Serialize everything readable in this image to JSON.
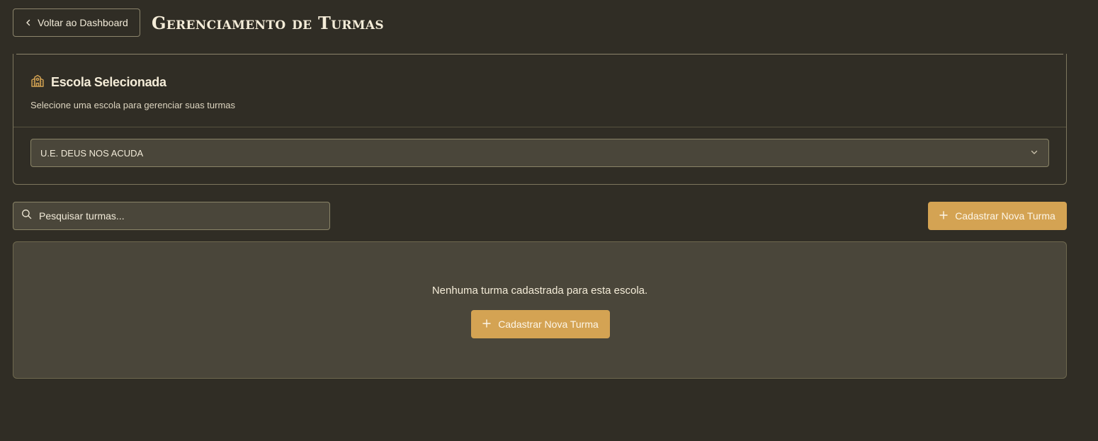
{
  "header": {
    "back_label": "Voltar ao Dashboard",
    "title": "Gerenciamento de Turmas"
  },
  "school_card": {
    "icon": "school-icon",
    "title": "Escola Selecionada",
    "subtitle": "Selecione uma escola para gerenciar suas turmas",
    "selected_school": "U.E. DEUS NOS ACUDA"
  },
  "toolbar": {
    "search_placeholder": "Pesquisar turmas...",
    "add_label": "Cadastrar Nova Turma"
  },
  "empty_state": {
    "message": "Nenhuma turma cadastrada para esta escola.",
    "add_label": "Cadastrar Nova Turma"
  },
  "colors": {
    "background": "#302d25",
    "panel": "#4a463a",
    "accent": "#d4a353",
    "text": "#f1ead8"
  }
}
